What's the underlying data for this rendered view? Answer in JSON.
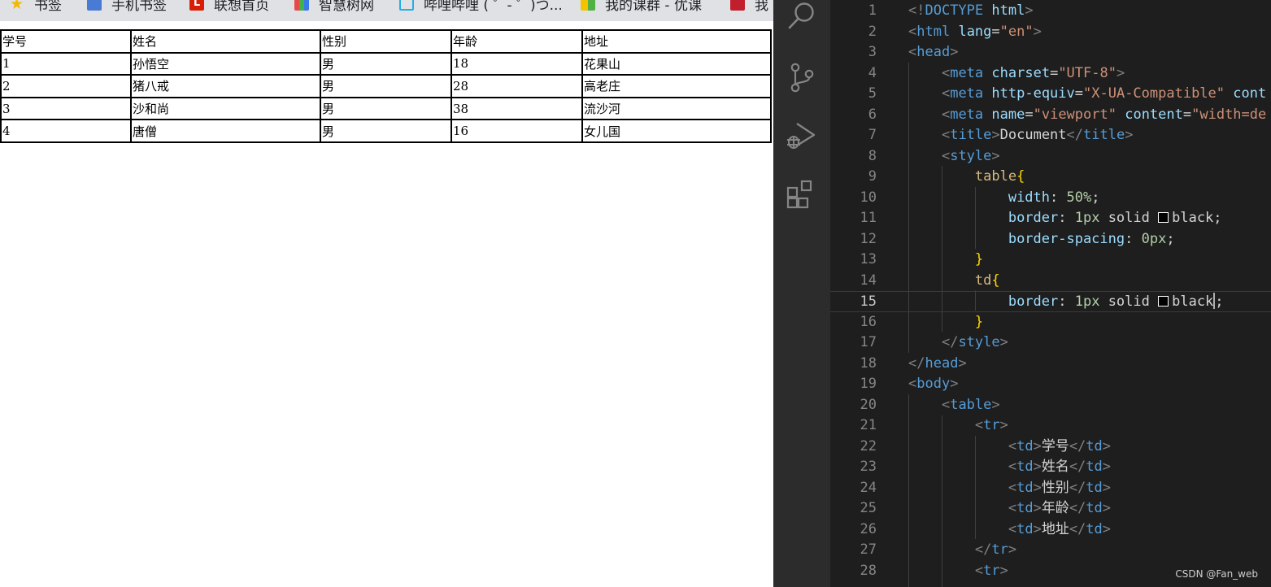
{
  "bookmarks": {
    "items": [
      {
        "label": "书签",
        "icon": "star-icon"
      },
      {
        "label": "手机书签",
        "icon": "phone-icon"
      },
      {
        "label": "联想首页",
        "icon": "lenovo-icon"
      },
      {
        "label": "智慧树网",
        "icon": "zhihuishu-icon"
      },
      {
        "label": "哔哩哔哩 ( ゜- ゜)つ...",
        "icon": "bilibili-icon"
      },
      {
        "label": "我的课群 - 优课",
        "icon": "class-icon"
      },
      {
        "label": "我",
        "icon": "red-app-icon"
      }
    ]
  },
  "table": {
    "headers": [
      "学号",
      "姓名",
      "性别",
      "年龄",
      "地址"
    ],
    "rows": [
      [
        "1",
        "孙悟空",
        "男",
        "18",
        "花果山"
      ],
      [
        "2",
        "猪八戒",
        "男",
        "28",
        "高老庄"
      ],
      [
        "3",
        "沙和尚",
        "男",
        "38",
        "流沙河"
      ],
      [
        "4",
        "唐僧",
        "男",
        "16",
        "女儿国"
      ]
    ]
  },
  "activity_bar": {
    "icons": [
      "search-icon",
      "source-control-icon",
      "run-debug-icon",
      "extensions-icon"
    ]
  },
  "editor": {
    "current_line": 15,
    "lines": [
      {
        "n": "1",
        "t": "<!DOCTYPE html>"
      },
      {
        "n": "2",
        "t": "<html lang=\"en\">"
      },
      {
        "n": "3",
        "t": "<head>"
      },
      {
        "n": "4",
        "t": "    <meta charset=\"UTF-8\">"
      },
      {
        "n": "5",
        "t": "    <meta http-equiv=\"X-UA-Compatible\" cont"
      },
      {
        "n": "6",
        "t": "    <meta name=\"viewport\" content=\"width=de"
      },
      {
        "n": "7",
        "t": "    <title>Document</title>"
      },
      {
        "n": "8",
        "t": "    <style>"
      },
      {
        "n": "9",
        "t": "        table{"
      },
      {
        "n": "10",
        "t": "            width: 50%;"
      },
      {
        "n": "11",
        "t": "            border: 1px solid black;"
      },
      {
        "n": "12",
        "t": "            border-spacing: 0px;"
      },
      {
        "n": "13",
        "t": "        }"
      },
      {
        "n": "14",
        "t": "        td{"
      },
      {
        "n": "15",
        "t": "            border: 1px solid black;"
      },
      {
        "n": "16",
        "t": "        }"
      },
      {
        "n": "17",
        "t": "    </style>"
      },
      {
        "n": "18",
        "t": "</head>"
      },
      {
        "n": "19",
        "t": "<body>"
      },
      {
        "n": "20",
        "t": "    <table>"
      },
      {
        "n": "21",
        "t": "        <tr>"
      },
      {
        "n": "22",
        "t": "            <td>学号</td>"
      },
      {
        "n": "23",
        "t": "            <td>姓名</td>"
      },
      {
        "n": "24",
        "t": "            <td>性别</td>"
      },
      {
        "n": "25",
        "t": "            <td>年龄</td>"
      },
      {
        "n": "26",
        "t": "            <td>地址</td>"
      },
      {
        "n": "27",
        "t": "        </tr>"
      },
      {
        "n": "28",
        "t": "        <tr>"
      }
    ]
  },
  "watermark": "CSDN @Fan_web",
  "colors": {
    "activity_bar_bg": "#2c2c2c",
    "editor_bg": "#1e1e1e",
    "tag": "#569cd6",
    "attribute": "#9cdcfe",
    "string": "#ce9178",
    "selector": "#d7ba7d",
    "number": "#b5cea8",
    "bracket": "#ffd700"
  }
}
